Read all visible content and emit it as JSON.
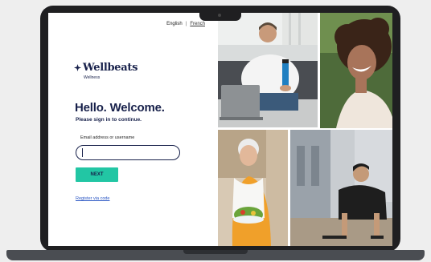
{
  "language": {
    "english": "English",
    "separator": "|",
    "french": "French"
  },
  "brand": {
    "name": "Wellbeats",
    "sub": "Wellness"
  },
  "welcome": {
    "title": "Hello. Welcome.",
    "subtitle": "Please sign in to continue."
  },
  "form": {
    "email_label": "Email address or username",
    "email_value": "",
    "next_label": "NEXT"
  },
  "register_link": "Register via code",
  "colors": {
    "navy": "#17204a",
    "teal": "#22c6a4",
    "link": "#2a56c4"
  }
}
